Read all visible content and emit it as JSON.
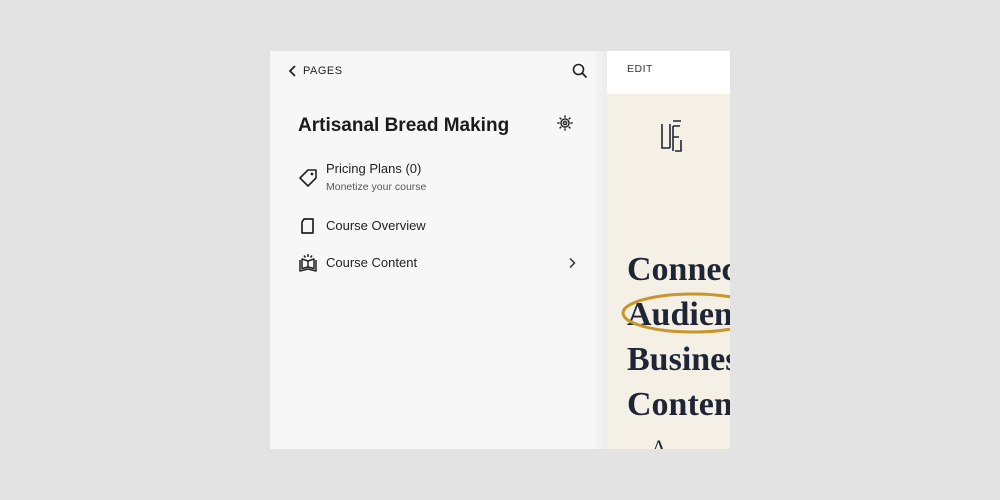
{
  "panel": {
    "back_label": "PAGES",
    "title": "Artisanal Bread Making",
    "items": [
      {
        "label": "Pricing Plans (0)",
        "sub": "Monetize your course",
        "icon": "tag-icon"
      },
      {
        "label": "Course Overview",
        "icon": "page-icon"
      },
      {
        "label": "Course Content",
        "icon": "book-icon"
      }
    ]
  },
  "preview": {
    "edit_label": "EDIT",
    "headline": "Connect\nAudience\nBusiness\nContent",
    "headline_tail": "A...",
    "colors": {
      "background": "#f4f0e6",
      "headline": "#1f2535",
      "highlight": "#c9962e"
    }
  }
}
